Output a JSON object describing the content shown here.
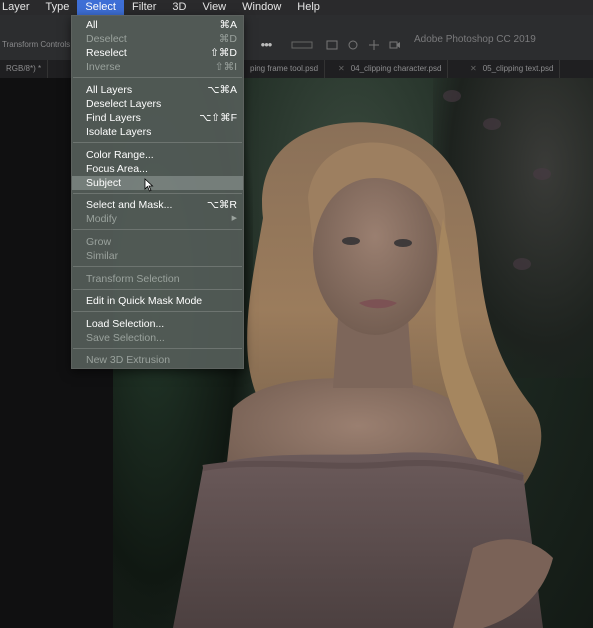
{
  "menubar": {
    "items": [
      "Layer",
      "Type",
      "Select",
      "Filter",
      "3D",
      "View",
      "Window",
      "Help"
    ],
    "active": "Select"
  },
  "options_bar": {
    "app_title": "Adobe Photoshop CC 2019",
    "label": "Transform Controls",
    "icons": [
      "more-icon",
      "align-icon",
      "distribute-icon",
      "3d-mode-icon",
      "move-icon",
      "video-icon"
    ]
  },
  "tabs": [
    {
      "label": "RGB/8*) *"
    },
    {
      "label": "ping frame tool.psd"
    },
    {
      "label": "04_clipping character.psd"
    },
    {
      "label": "05_clipping text.psd"
    }
  ],
  "select_menu": {
    "items": [
      {
        "label": "All",
        "shortcut": "⌘A",
        "enabled": true
      },
      {
        "label": "Deselect",
        "shortcut": "⌘D",
        "enabled": false
      },
      {
        "label": "Reselect",
        "shortcut": "⇧⌘D",
        "enabled": true
      },
      {
        "label": "Inverse",
        "shortcut": "⇧⌘I",
        "enabled": false
      },
      {
        "label": "All Layers",
        "shortcut": "⌥⌘A",
        "enabled": true
      },
      {
        "label": "Deselect Layers",
        "shortcut": "",
        "enabled": true
      },
      {
        "label": "Find Layers",
        "shortcut": "⌥⇧⌘F",
        "enabled": true
      },
      {
        "label": "Isolate Layers",
        "shortcut": "",
        "enabled": true
      },
      {
        "label": "Color Range...",
        "shortcut": "",
        "enabled": true
      },
      {
        "label": "Focus Area...",
        "shortcut": "",
        "enabled": true
      },
      {
        "label": "Subject",
        "shortcut": "",
        "enabled": true,
        "highlighted": true
      },
      {
        "label": "Select and Mask...",
        "shortcut": "⌥⌘R",
        "enabled": true
      },
      {
        "label": "Modify",
        "shortcut": "▶",
        "enabled": false
      },
      {
        "label": "Grow",
        "shortcut": "",
        "enabled": false
      },
      {
        "label": "Similar",
        "shortcut": "",
        "enabled": false
      },
      {
        "label": "Transform Selection",
        "shortcut": "",
        "enabled": false
      },
      {
        "label": "Edit in Quick Mask Mode",
        "shortcut": "",
        "enabled": true
      },
      {
        "label": "Load Selection...",
        "shortcut": "",
        "enabled": true
      },
      {
        "label": "Save Selection...",
        "shortcut": "",
        "enabled": false
      },
      {
        "label": "New 3D Extrusion",
        "shortcut": "",
        "enabled": false
      }
    ]
  },
  "colors": {
    "menubar_active": "#3e6fd6",
    "menu_bg": "#545c58",
    "canvas_bg": "#101011"
  }
}
